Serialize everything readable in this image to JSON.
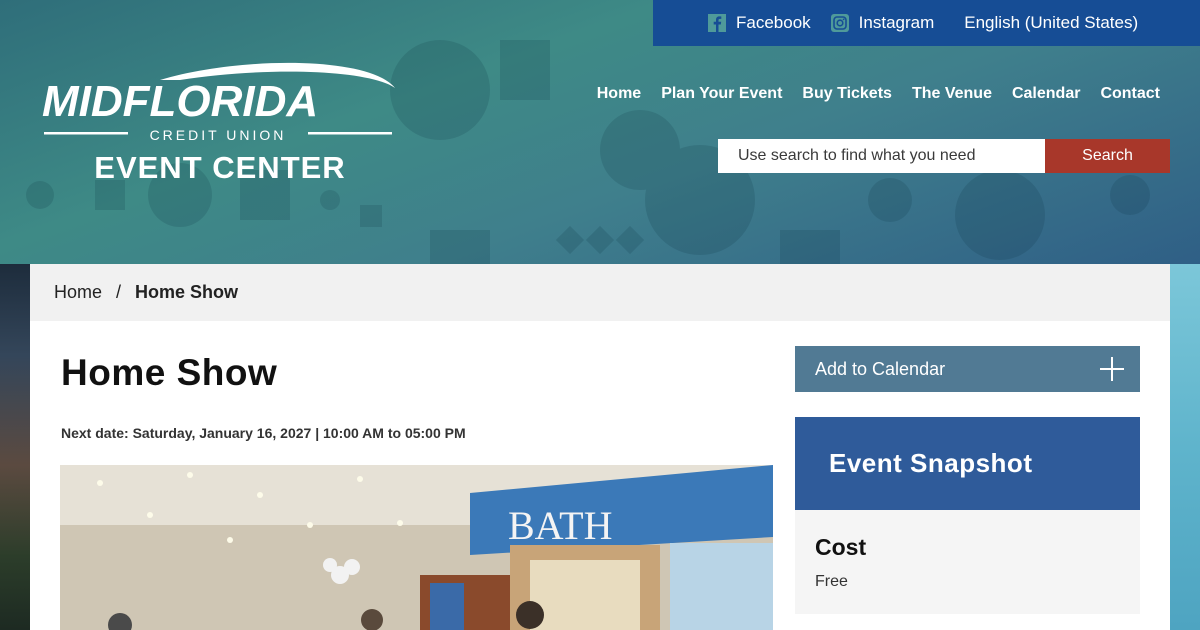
{
  "topbar": {
    "facebook": "Facebook",
    "instagram": "Instagram",
    "language": "English (United States)"
  },
  "logo": {
    "line1": "MIDFLORIDA",
    "line2": "CREDIT UNION",
    "line3": "EVENT CENTER"
  },
  "nav": [
    "Home",
    "Plan Your Event",
    "Buy Tickets",
    "The Venue",
    "Calendar",
    "Contact"
  ],
  "search": {
    "placeholder": "Use search to find what you need",
    "button": "Search"
  },
  "breadcrumb": {
    "home": "Home",
    "separator": "/",
    "current": "Home Show"
  },
  "event": {
    "title": "Home Show",
    "next_date": "Next date: Saturday, January 16, 2027 | 10:00 AM to 05:00 PM",
    "photo_sign": "BATH"
  },
  "sidebar": {
    "add_to_calendar": "Add to Calendar",
    "snapshot_title": "Event Snapshot",
    "cost_label": "Cost",
    "cost_value": "Free"
  },
  "colors": {
    "topbar": "#164d95",
    "search_button": "#a8372a",
    "add_calendar": "#517a94",
    "snapshot_header": "#2f5b9a"
  }
}
